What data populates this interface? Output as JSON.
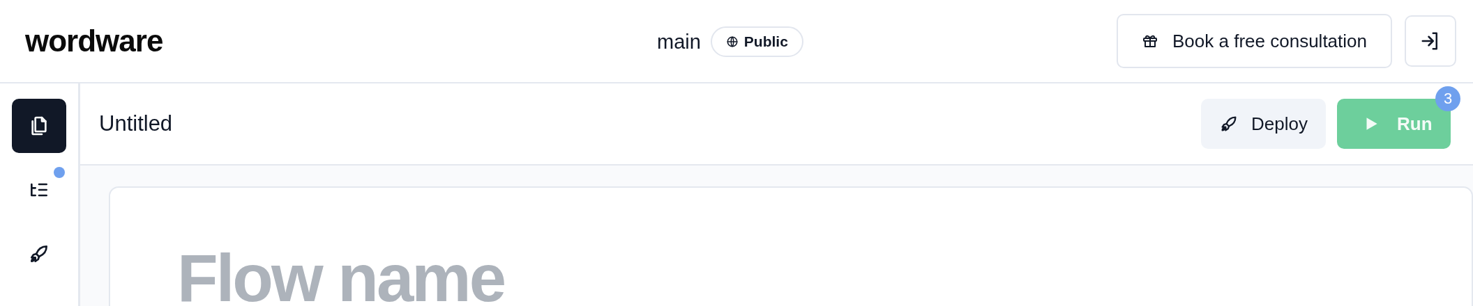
{
  "header": {
    "logo": "wordware",
    "branch": "main",
    "visibility": {
      "label": "Public"
    },
    "consult_button": {
      "label": "Book a free consultation"
    }
  },
  "sidebar": {
    "items": [
      {
        "kind": "files",
        "selected": true,
        "notification": false
      },
      {
        "kind": "outline",
        "selected": false,
        "notification": true
      },
      {
        "kind": "rocket",
        "selected": false,
        "notification": false
      }
    ]
  },
  "toolbar": {
    "title": "Untitled",
    "deploy_button": {
      "label": "Deploy"
    },
    "run_button": {
      "label": "Run",
      "badge": "3"
    }
  },
  "editor": {
    "name_field": {
      "placeholder": "Flow name"
    }
  }
}
